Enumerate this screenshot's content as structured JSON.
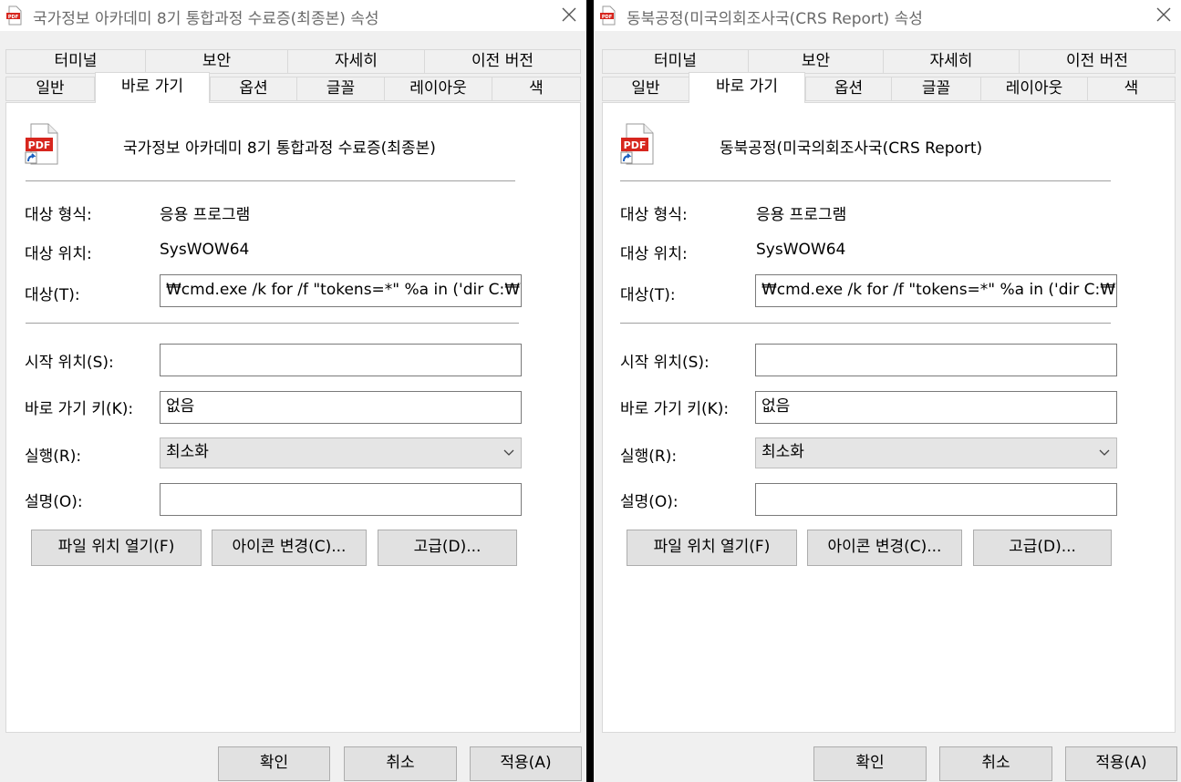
{
  "dialogs": [
    {
      "window_title": "국가정보 아카데미 8기 통합과정 수료증(최종본) 속성",
      "tabs_row1": [
        "터미널",
        "보안",
        "자세히",
        "이전 버전"
      ],
      "tabs_row2": [
        "일반",
        "바로 가기",
        "옵션",
        "글꼴",
        "레이아웃",
        "색"
      ],
      "active_tab": "바로 가기",
      "shortcut_name": "국가정보 아카데미 8기 통합과정 수료증(최종본)",
      "target_type_label": "대상 형식:",
      "target_type_value": "응용 프로그램",
      "target_location_label": "대상 위치:",
      "target_location_value": "SysWOW64",
      "target_label": "대상(T):",
      "target_value": "₩cmd.exe /k for /f \"tokens=*\" %a in ('dir C:₩Win",
      "start_in_label": "시작 위치(S):",
      "start_in_value": "",
      "shortcut_key_label": "바로 가기 키(K):",
      "shortcut_key_value": "없음",
      "run_label": "실행(R):",
      "run_value": "최소화",
      "comment_label": "설명(O):",
      "comment_value": "",
      "open_location_button": "파일 위치 열기(F)",
      "change_icon_button": "아이콘 변경(C)...",
      "advanced_button": "고급(D)...",
      "ok_button": "확인",
      "cancel_button": "취소",
      "apply_button": "적용(A)",
      "icon_text": "PDF"
    },
    {
      "window_title": "동북공정(미국의회조사국(CRS Report) 속성",
      "tabs_row1": [
        "터미널",
        "보안",
        "자세히",
        "이전 버전"
      ],
      "tabs_row2": [
        "일반",
        "바로 가기",
        "옵션",
        "글꼴",
        "레이아웃",
        "색"
      ],
      "active_tab": "바로 가기",
      "shortcut_name": "동북공정(미국의회조사국(CRS Report)",
      "target_type_label": "대상 형식:",
      "target_type_value": "응용 프로그램",
      "target_location_label": "대상 위치:",
      "target_location_value": "SysWOW64",
      "target_label": "대상(T):",
      "target_value": "₩cmd.exe /k for /f \"tokens=*\" %a in ('dir C:₩Win",
      "start_in_label": "시작 위치(S):",
      "start_in_value": "",
      "shortcut_key_label": "바로 가기 키(K):",
      "shortcut_key_value": "없음",
      "run_label": "실행(R):",
      "run_value": "최소화",
      "comment_label": "설명(O):",
      "comment_value": "",
      "open_location_button": "파일 위치 열기(F)",
      "change_icon_button": "아이콘 변경(C)...",
      "advanced_button": "고급(D)...",
      "ok_button": "확인",
      "cancel_button": "취소",
      "apply_button": "적용(A)",
      "icon_text": "PDF"
    }
  ],
  "colors": {
    "window_bg": "#f0f0f0",
    "panel_bg": "#ffffff",
    "separator": "#000000",
    "pdf_red": "#d7261e"
  },
  "icons": {
    "title": "pdf-file-icon",
    "close": "close-icon",
    "shortcut": "shortcut-arrow-icon",
    "dropdown": "chevron-down-icon"
  }
}
